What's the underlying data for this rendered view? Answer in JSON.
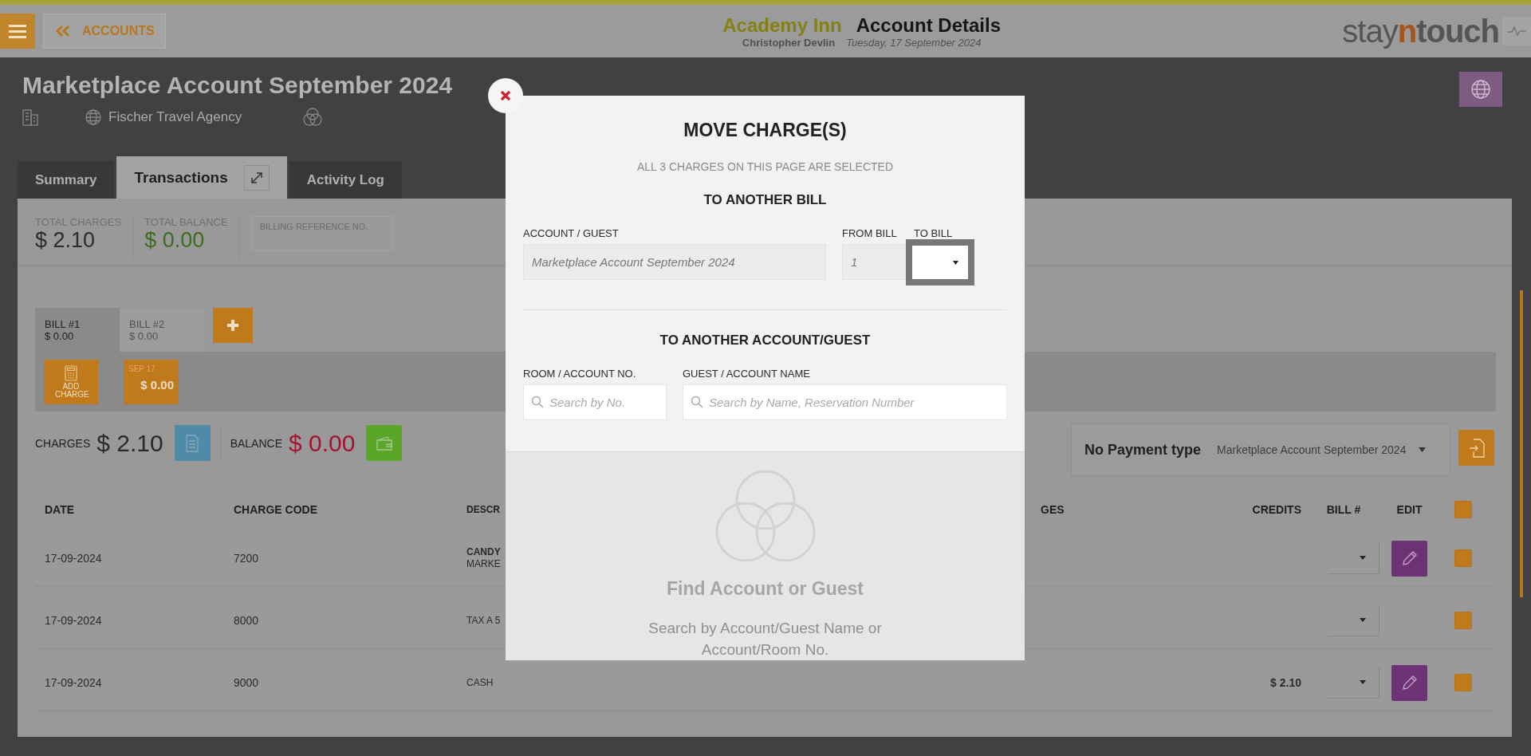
{
  "header": {
    "back_label": "ACCOUNTS",
    "hotel": "Academy Inn",
    "title": "Account Details",
    "user": "Christopher Devlin",
    "date": "Tuesday, 17 September 2024",
    "logo": [
      {
        "text": "stay",
        "kind": "light"
      },
      {
        "text": "n",
        "kind": "accent"
      },
      {
        "text": "touch",
        "kind": "bold"
      }
    ]
  },
  "account": {
    "title": "Marketplace Account September 2024",
    "agency": "Fischer Travel Agency"
  },
  "tabs": [
    {
      "label": "Summary",
      "selected": false
    },
    {
      "label": "Transactions",
      "selected": true
    },
    {
      "label": "Activity Log",
      "selected": false
    }
  ],
  "totals": [
    {
      "label": "TOTAL CHARGES",
      "value": "$ 2.10",
      "kind": "neutral"
    },
    {
      "label": "TOTAL BALANCE",
      "value": "$ 0.00",
      "kind": "positive"
    }
  ],
  "billing_reference": {
    "label": "BILLING REFERENCE NO."
  },
  "bills": [
    {
      "label": "BILL #1",
      "amount": "$ 0.00",
      "selected": true
    },
    {
      "label": "BILL #2",
      "amount": "$ 0.00",
      "selected": false
    }
  ],
  "add_charge": {
    "label": "ADD CHARGE"
  },
  "date_chip": {
    "date": "SEP 17",
    "amount": "$ 0.00"
  },
  "summary": {
    "charges_label": "CHARGES",
    "charges": "$ 2.10",
    "balance_label": "BALANCE",
    "balance": "$ 0.00"
  },
  "payment": {
    "type": "No Payment type",
    "account": "Marketplace Account September 2024"
  },
  "table": {
    "columns": [
      "DATE",
      "CHARGE CODE",
      "DESCR",
      "GES",
      "CREDITS",
      "BILL #",
      "EDIT"
    ],
    "all_checked": true,
    "rows": [
      {
        "date": "17-09-2024",
        "code": "7200",
        "description": "CANDY",
        "sub": "MARKE",
        "credits": "",
        "editable": true,
        "checked": true
      },
      {
        "date": "17-09-2024",
        "code": "8000",
        "description": "TAX A 5",
        "sub": "",
        "credits": "",
        "editable": false,
        "checked": true
      },
      {
        "date": "17-09-2024",
        "code": "9000",
        "description": "CASH",
        "sub": "",
        "credits": "$ 2.10",
        "editable": true,
        "checked": true
      }
    ]
  },
  "modal": {
    "title": "MOVE CHARGE(S)",
    "subtitle": "ALL 3 CHARGES ON THIS PAGE ARE SELECTED",
    "bill_section": "TO ANOTHER BILL",
    "account_label": "ACCOUNT / GUEST",
    "account_value": "Marketplace Account September 2024",
    "from_label": "FROM BILL",
    "from_value": "1",
    "to_label": "TO BILL",
    "to_focused": true,
    "guest_section": "TO ANOTHER ACCOUNT/GUEST",
    "room_label": "ROOM / ACCOUNT NO.",
    "room_placeholder": "Search by No.",
    "name_label": "GUEST / ACCOUNT NAME",
    "name_placeholder": "Search by Name, Reservation Number",
    "empty_title": "Find Account or Guest",
    "empty_text": "Search by Account/Guest Name or Account/Room No."
  }
}
